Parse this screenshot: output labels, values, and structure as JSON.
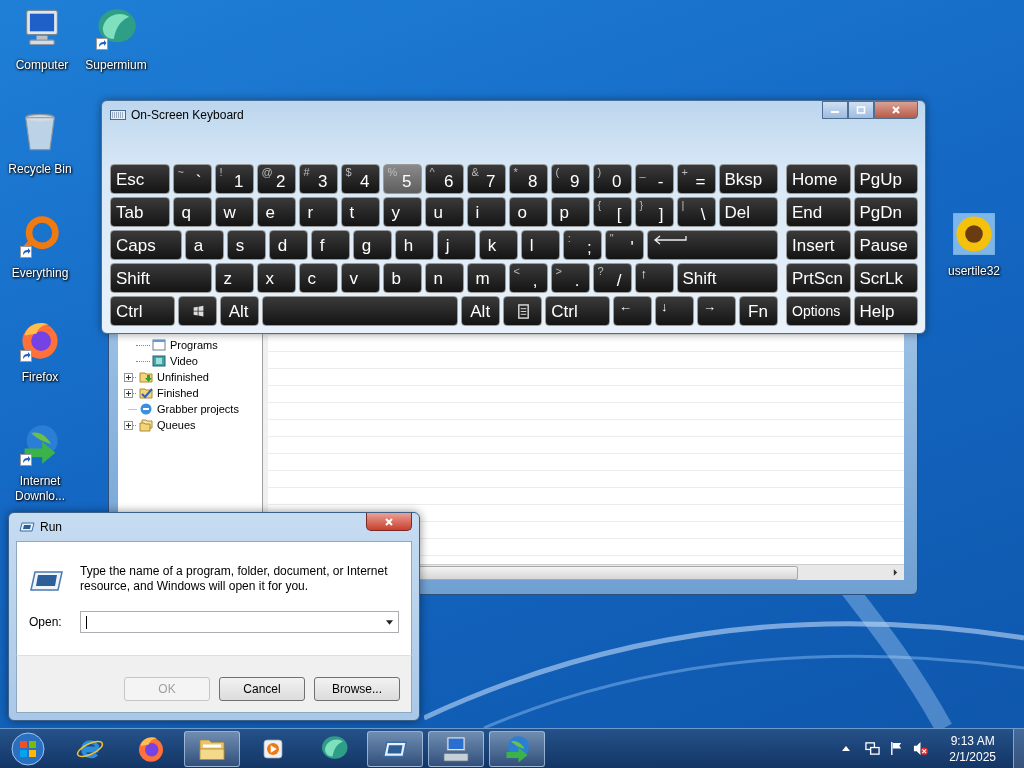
{
  "desktop_icons": [
    {
      "label": "Computer",
      "kind": "computer",
      "shortcut": false
    },
    {
      "label": "Supermium",
      "kind": "supermium",
      "shortcut": true
    },
    {
      "label": "Recycle Bin",
      "kind": "recycle",
      "shortcut": false
    },
    {
      "label": "Everything",
      "kind": "ring",
      "shortcut": true
    },
    {
      "label": "Firefox",
      "kind": "firefox",
      "shortcut": true
    },
    {
      "label": "Internet Downlo...",
      "kind": "globe",
      "shortcut": true
    },
    {
      "label": "usertile32",
      "kind": "sunflower",
      "shortcut": false
    }
  ],
  "download_manager": {
    "tree": [
      {
        "children": [
          {
            "label": "Programs",
            "kind": "programs"
          },
          {
            "label": "Video",
            "kind": "video"
          }
        ]
      },
      {
        "label": "Unfinished",
        "kind": "unfinished",
        "expandable": true
      },
      {
        "label": "Finished",
        "kind": "finished",
        "expandable": true
      },
      {
        "label": "Grabber projects",
        "kind": "grabber",
        "expandable": false
      },
      {
        "label": "Queues",
        "kind": "queues",
        "expandable": true
      }
    ]
  },
  "keyboard": {
    "title": "On-Screen Keyboard",
    "main_rows": [
      [
        {
          "label": "Esc",
          "kind": "mod",
          "hover": false
        },
        {
          "top": "~",
          "label": "`",
          "kind": "char",
          "hover": false
        },
        {
          "top": "!",
          "label": "1",
          "kind": "char",
          "hover": false
        },
        {
          "top": "@",
          "label": "2",
          "kind": "char",
          "hover": false
        },
        {
          "top": "#",
          "label": "3",
          "kind": "char",
          "hover": false
        },
        {
          "top": "$",
          "label": "4",
          "kind": "char",
          "hover": false
        },
        {
          "top": "%",
          "label": "5",
          "kind": "char",
          "hover": true
        },
        {
          "top": "^",
          "label": "6",
          "kind": "char",
          "hover": false
        },
        {
          "top": "&",
          "label": "7",
          "kind": "char",
          "hover": false
        },
        {
          "top": "*",
          "label": "8",
          "kind": "char",
          "hover": false
        },
        {
          "top": "(",
          "label": "9",
          "kind": "char",
          "hover": false
        },
        {
          "top": ")",
          "label": "0",
          "kind": "char",
          "hover": false
        },
        {
          "top": "_",
          "label": "-",
          "kind": "char",
          "hover": false
        },
        {
          "top": "+",
          "label": "=",
          "kind": "char",
          "hover": false
        },
        {
          "label": "Bksp",
          "kind": "mod",
          "hover": false
        }
      ],
      [
        {
          "label": "Tab",
          "kind": "mod",
          "hover": false
        },
        {
          "label": "q",
          "kind": "char",
          "hover": false
        },
        {
          "label": "w",
          "kind": "char",
          "hover": false
        },
        {
          "label": "e",
          "kind": "char",
          "hover": false
        },
        {
          "label": "r",
          "kind": "char",
          "hover": false
        },
        {
          "label": "t",
          "kind": "char",
          "hover": false
        },
        {
          "label": "y",
          "kind": "char",
          "hover": false
        },
        {
          "label": "u",
          "kind": "char",
          "hover": false
        },
        {
          "label": "i",
          "kind": "char",
          "hover": false
        },
        {
          "label": "o",
          "kind": "char",
          "hover": false
        },
        {
          "label": "p",
          "kind": "char",
          "hover": false
        },
        {
          "top": "{",
          "label": "[",
          "kind": "char",
          "hover": false
        },
        {
          "top": "}",
          "label": "]",
          "kind": "char",
          "hover": false
        },
        {
          "top": "|",
          "label": "\\",
          "kind": "char",
          "hover": false
        },
        {
          "label": "Del",
          "kind": "mod",
          "hover": false
        }
      ],
      [
        {
          "label": "Caps",
          "kind": "mod",
          "hover": false
        },
        {
          "label": "a",
          "kind": "char",
          "hover": false
        },
        {
          "label": "s",
          "kind": "char",
          "hover": false
        },
        {
          "label": "d",
          "kind": "char",
          "hover": false
        },
        {
          "label": "f",
          "kind": "char",
          "hover": false
        },
        {
          "label": "g",
          "kind": "char",
          "hover": false
        },
        {
          "label": "h",
          "kind": "char",
          "hover": false
        },
        {
          "label": "j",
          "kind": "char",
          "hover": false
        },
        {
          "label": "k",
          "kind": "char",
          "hover": false
        },
        {
          "label": "l",
          "kind": "char",
          "hover": false
        },
        {
          "top": ":",
          "label": ";",
          "kind": "char",
          "hover": false
        },
        {
          "top": "\"",
          "label": "'",
          "kind": "char",
          "hover": false
        },
        {
          "kind": "enter",
          "hover": false
        }
      ],
      [
        {
          "label": "Shift",
          "kind": "mod",
          "hover": false
        },
        {
          "label": "z",
          "kind": "char",
          "hover": false
        },
        {
          "label": "x",
          "kind": "char",
          "hover": false
        },
        {
          "label": "c",
          "kind": "char",
          "hover": false
        },
        {
          "label": "v",
          "kind": "char",
          "hover": false
        },
        {
          "label": "b",
          "kind": "char",
          "hover": false
        },
        {
          "label": "n",
          "kind": "char",
          "hover": false
        },
        {
          "label": "m",
          "kind": "char",
          "hover": false
        },
        {
          "top": "<",
          "label": ",",
          "kind": "char",
          "hover": false
        },
        {
          "top": ">",
          "label": ".",
          "kind": "char",
          "hover": false
        },
        {
          "top": "?",
          "label": "/",
          "kind": "char",
          "hover": false
        },
        {
          "label": "↑",
          "kind": "arrow",
          "hover": false
        },
        {
          "label": "Shift",
          "kind": "mod",
          "hover": false
        }
      ],
      [
        {
          "label": "Ctrl",
          "kind": "mod",
          "hover": false
        },
        {
          "kind": "win",
          "hover": false
        },
        {
          "label": "Alt",
          "kind": "char",
          "hover": false
        },
        {
          "kind": "space",
          "hover": false
        },
        {
          "label": "Alt",
          "kind": "char",
          "hover": false
        },
        {
          "kind": "menu",
          "hover": false
        },
        {
          "label": "Ctrl",
          "kind": "mod",
          "hover": false
        },
        {
          "label": "←",
          "kind": "arrow",
          "hover": false
        },
        {
          "label": "↓",
          "kind": "arrow",
          "hover": false
        },
        {
          "label": "→",
          "kind": "arrow",
          "hover": false
        },
        {
          "label": "Fn",
          "kind": "char",
          "hover": false
        }
      ]
    ],
    "nav_rows": [
      [
        {
          "label": "Home",
          "kind": "nav",
          "hover": false
        },
        {
          "label": "PgUp",
          "kind": "nav",
          "hover": false
        }
      ],
      [
        {
          "label": "End",
          "kind": "nav",
          "hover": false
        },
        {
          "label": "PgDn",
          "kind": "nav",
          "hover": false
        }
      ],
      [
        {
          "label": "Insert",
          "kind": "nav",
          "hover": false
        },
        {
          "label": "Pause",
          "kind": "nav",
          "hover": false
        }
      ],
      [
        {
          "label": "PrtScn",
          "kind": "nav",
          "hover": false
        },
        {
          "label": "ScrLk",
          "kind": "nav",
          "hover": false
        }
      ],
      [
        {
          "label": "Options",
          "kind": "nav-small",
          "hover": false
        },
        {
          "label": "Help",
          "kind": "nav",
          "hover": false
        }
      ]
    ]
  },
  "run_dialog": {
    "title": "Run",
    "description": "Type the name of a program, folder, document, or Internet resource, and Windows will open it for you.",
    "open_label": "Open:",
    "buttons": [
      {
        "label": "OK",
        "disabled": true
      },
      {
        "label": "Cancel",
        "disabled": false
      },
      {
        "label": "Browse...",
        "disabled": false
      }
    ]
  },
  "taskbar": {
    "apps": [
      {
        "kind": "ie",
        "running": false
      },
      {
        "kind": "firefox",
        "running": false
      },
      {
        "kind": "folder",
        "running": true
      },
      {
        "kind": "media",
        "running": false
      },
      {
        "kind": "supermium",
        "running": false
      },
      {
        "kind": "run",
        "running": true
      },
      {
        "kind": "keyboard",
        "running": true
      },
      {
        "kind": "globe",
        "running": true
      }
    ],
    "time": "9:13 AM",
    "date": "2/1/2025"
  }
}
